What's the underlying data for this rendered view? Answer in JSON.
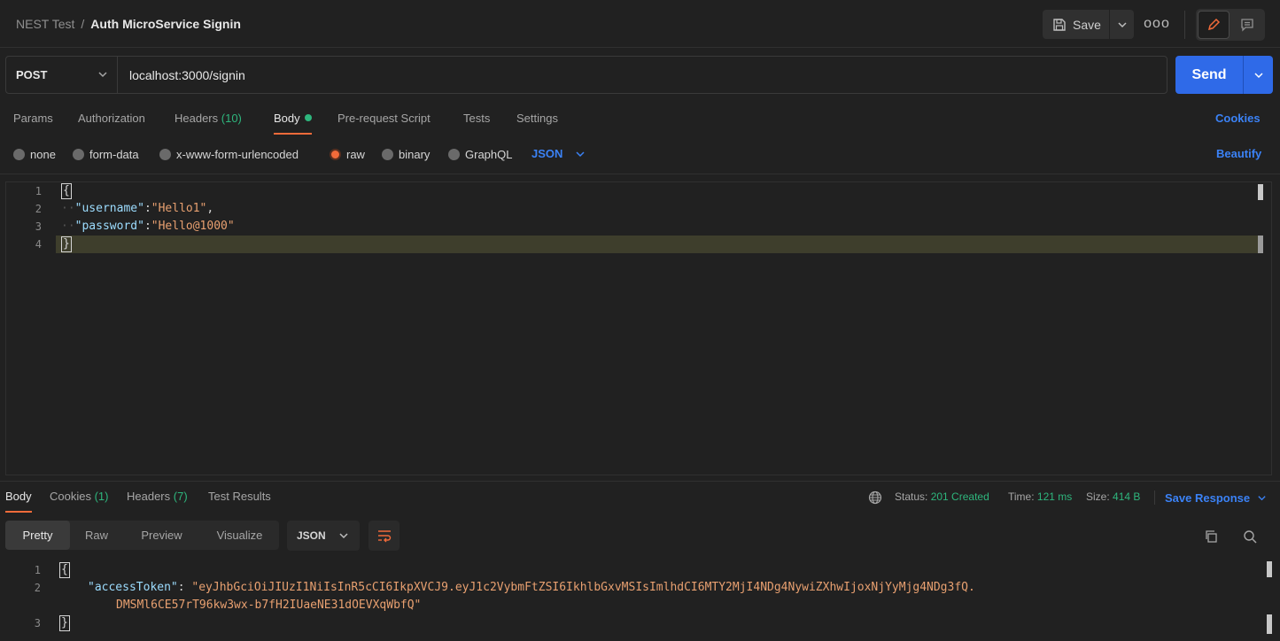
{
  "breadcrumb": {
    "parent": "NEST Test",
    "separator": "/",
    "current": "Auth MicroService Signin"
  },
  "toolbar": {
    "save_label": "Save",
    "more_icon": "ooo"
  },
  "request": {
    "method": "POST",
    "url": "localhost:3000/signin",
    "send_label": "Send"
  },
  "request_tabs": {
    "params": "Params",
    "authorization": "Authorization",
    "headers": "Headers",
    "headers_count": "(10)",
    "body": "Body",
    "pre_request": "Pre-request Script",
    "tests": "Tests",
    "settings": "Settings",
    "cookies": "Cookies"
  },
  "body_types": {
    "none": "none",
    "form_data": "form-data",
    "urlencoded": "x-www-form-urlencoded",
    "raw": "raw",
    "binary": "binary",
    "graphql": "GraphQL",
    "language": "JSON",
    "beautify": "Beautify"
  },
  "request_body": {
    "line_numbers": [
      "1",
      "2",
      "3",
      "4"
    ],
    "open_brace": "{",
    "close_brace": "}",
    "indent": "··",
    "username_key": "\"username\"",
    "username_value": "\"Hello1\"",
    "password_key": "\"password\"",
    "password_value": "\"Hello@1000\"",
    "colon": ":",
    "comma": ","
  },
  "response_tabs": {
    "body": "Body",
    "cookies": "Cookies",
    "cookies_count": "(1)",
    "headers": "Headers",
    "headers_count": "(7)",
    "test_results": "Test Results"
  },
  "response_status": {
    "status_label": "Status:",
    "status_value": "201 Created",
    "time_label": "Time:",
    "time_value": "121 ms",
    "size_label": "Size:",
    "size_value": "414 B",
    "save_response": "Save Response"
  },
  "response_view": {
    "pretty": "Pretty",
    "raw": "Raw",
    "preview": "Preview",
    "visualize": "Visualize",
    "format": "JSON"
  },
  "response_body": {
    "line_numbers": [
      "1",
      "2",
      "3"
    ],
    "open_brace": "{",
    "close_brace": "}",
    "access_token_key": "\"accessToken\"",
    "colon": ":",
    "access_token_value_part1": "\"eyJhbGciOiJIUzI1NiIsInR5cCI6IkpXVCJ9.eyJ1c2VybmFtZSI6IkhlbGxvMSIsImlhdCI6MTY2MjI4NDg4NywiZXhwIjoxNjYyMjg4NDg3fQ.",
    "access_token_value_part2": "DMSMl6CE57rT96kw3wx-b7fH2IUaeNE31dOEVXqWbfQ\""
  },
  "colors": {
    "accent": "#f26b3a",
    "link": "#3b82f6",
    "success": "#2eb67d",
    "send": "#2f6ae8"
  }
}
